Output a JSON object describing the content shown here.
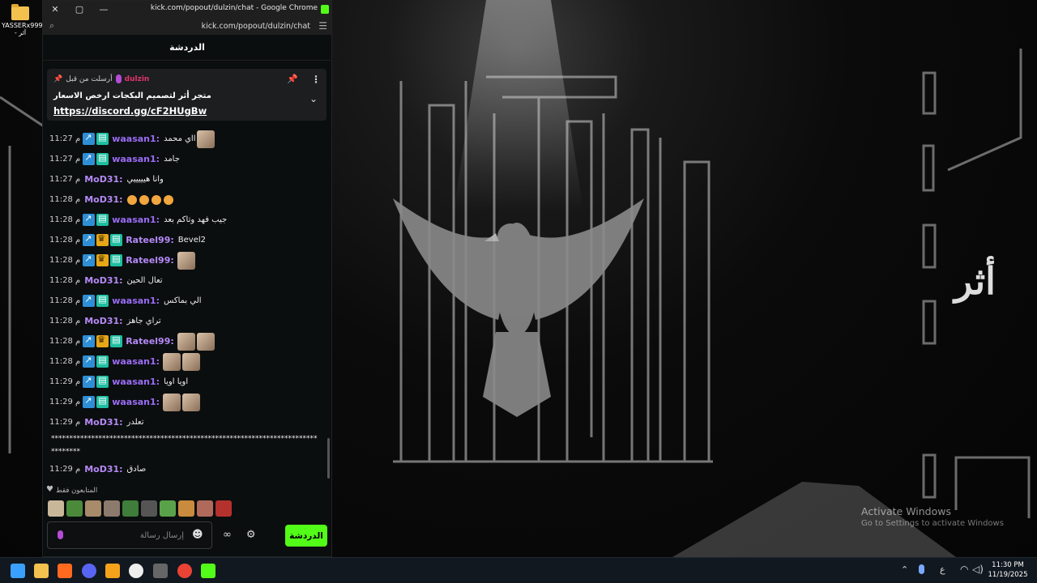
{
  "desktop": {
    "icon_label": "YASSERx999 - آثر",
    "watermark_title": "Activate Windows",
    "watermark_sub": "Go to Settings to activate Windows",
    "side_text": "أثر"
  },
  "window": {
    "title": "kick.com/popout/dulzin/chat - Google Chrome",
    "url": "kick.com/popout/dulzin/chat",
    "close_glyph": "✕",
    "restore_glyph": "▢",
    "minimize_glyph": "—"
  },
  "chat": {
    "header": "الدردشة",
    "pinned": {
      "author": "dulzin",
      "sent_by_label": "أرسلت من قبل",
      "text": "متجر أثر لتصميم البكجات ارخص الاسعار",
      "link": "https://discord.gg/cF2HUgBw"
    },
    "messages": [
      {
        "time": "11:27 م",
        "user": "waasan1:",
        "color": "#9b6cf5",
        "badges": [
          "blue",
          "green"
        ],
        "text": "ااي محمد",
        "emotes": 1
      },
      {
        "time": "11:27 م",
        "user": "waasan1:",
        "color": "#9b6cf5",
        "badges": [
          "blue",
          "green"
        ],
        "text": "جامد",
        "emotes": 0
      },
      {
        "time": "11:27 م",
        "user": "MoD31:",
        "color": "#b58af7",
        "badges": [],
        "text": "وانا هيييييي",
        "emotes": 0
      },
      {
        "time": "11:28 م",
        "user": "MoD31:",
        "color": "#b58af7",
        "badges": [],
        "text": "",
        "emotes": 0,
        "emojis": 4
      },
      {
        "time": "11:28 م",
        "user": "waasan1:",
        "color": "#9b6cf5",
        "badges": [
          "blue",
          "green"
        ],
        "text": "جيب فهد وتاكم بعد",
        "emotes": 0
      },
      {
        "time": "11:28 م",
        "user": "Rateel99:",
        "color": "#b58af7",
        "badges": [
          "blue",
          "gold",
          "green"
        ],
        "text": "Bevel2",
        "emotes": 0
      },
      {
        "time": "11:28 م",
        "user": "Rateel99:",
        "color": "#b58af7",
        "badges": [
          "blue",
          "gold",
          "green"
        ],
        "text": "",
        "emotes": 1
      },
      {
        "time": "11:28 م",
        "user": "MoD31:",
        "color": "#b58af7",
        "badges": [],
        "text": "تعال الحين",
        "emotes": 0
      },
      {
        "time": "11:28 م",
        "user": "waasan1:",
        "color": "#9b6cf5",
        "badges": [
          "blue",
          "green"
        ],
        "text": "الي بماكس",
        "emotes": 0
      },
      {
        "time": "11:28 م",
        "user": "MoD31:",
        "color": "#b58af7",
        "badges": [],
        "text": "تراي جاهز",
        "emotes": 0
      },
      {
        "time": "11:28 م",
        "user": "Rateel99:",
        "color": "#b58af7",
        "badges": [
          "blue",
          "gold",
          "green"
        ],
        "text": "",
        "emotes": 2
      },
      {
        "time": "11:28 م",
        "user": "waasan1:",
        "color": "#9b6cf5",
        "badges": [
          "blue",
          "green"
        ],
        "text": "",
        "emotes": 2
      },
      {
        "time": "11:29 م",
        "user": "waasan1:",
        "color": "#9b6cf5",
        "badges": [
          "blue",
          "green"
        ],
        "text": "اويا اويا",
        "emotes": 0
      },
      {
        "time": "11:29 م",
        "user": "waasan1:",
        "color": "#9b6cf5",
        "badges": [
          "blue",
          "green"
        ],
        "text": "",
        "emotes": 2
      },
      {
        "time": "11:29 م",
        "user": "MoD31:",
        "color": "#b58af7",
        "badges": [],
        "text": "تعلدر",
        "emotes": 0
      }
    ],
    "long_message": "*********************************************************************************",
    "last_message": {
      "time": "11:29 م",
      "user": "MoD31:",
      "text": "صادق"
    },
    "emote_bar_label": "المتابعون فقط",
    "input_placeholder": "إرسال رسالة",
    "send_button": "الدردشة"
  },
  "taskbar": {
    "time": "11:30 PM",
    "date": "11/19/2025",
    "lang": "ع"
  }
}
